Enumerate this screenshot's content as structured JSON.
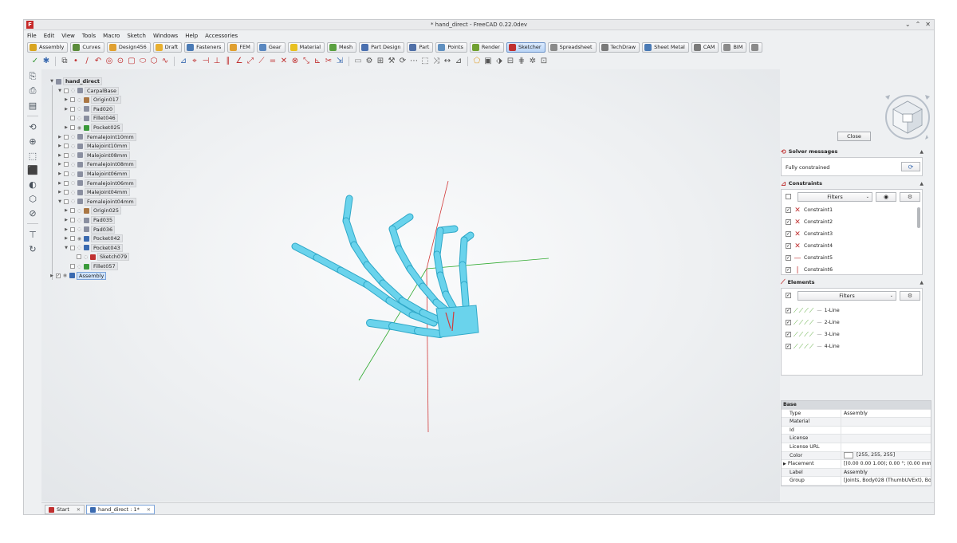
{
  "window": {
    "title": "* hand_direct - FreeCAD 0.22.0dev",
    "logo": "F",
    "btn_min": "⌄",
    "btn_max": "⌃",
    "btn_close": "✕"
  },
  "menu": [
    "File",
    "Edit",
    "View",
    "Tools",
    "Macro",
    "Sketch",
    "Windows",
    "Help",
    "Accessories"
  ],
  "workbenches": [
    {
      "label": "Assembly",
      "color": "#d9a520"
    },
    {
      "label": "Curves",
      "color": "#5b8c3a"
    },
    {
      "label": "Design456",
      "color": "#e0a030"
    },
    {
      "label": "Draft",
      "color": "#e8b030"
    },
    {
      "label": "Fasteners",
      "color": "#4a7ab5"
    },
    {
      "label": "FEM",
      "color": "#e0a030"
    },
    {
      "label": "Gear",
      "color": "#5a88c0"
    },
    {
      "label": "Material",
      "color": "#e8c020"
    },
    {
      "label": "Mesh",
      "color": "#5aa040"
    },
    {
      "label": "Part Design",
      "color": "#4a70b0"
    },
    {
      "label": "Part",
      "color": "#5070a8"
    },
    {
      "label": "Points",
      "color": "#6090c0"
    },
    {
      "label": "Render",
      "color": "#70a030"
    },
    {
      "label": "Sketcher",
      "color": "#c03030"
    },
    {
      "label": "Spreadsheet",
      "color": "#8a8a8a"
    },
    {
      "label": "TechDraw",
      "color": "#7a7a7a"
    },
    {
      "label": "Sheet Metal",
      "color": "#4a7ab5"
    },
    {
      "label": "CAM",
      "color": "#7a7a7a"
    },
    {
      "label": "BIM",
      "color": "#8a8a8a"
    },
    {
      "label": "",
      "color": "#8a8a8a"
    }
  ],
  "toolbar_icons": [
    {
      "glyph": "✓",
      "color": "#3a9a3a"
    },
    {
      "glyph": "✱",
      "color": "#3a6ab0"
    },
    {
      "glyph": "⧉",
      "color": "#555"
    },
    {
      "glyph": "•",
      "color": "#c03030"
    },
    {
      "glyph": "∕",
      "color": "#c03030"
    },
    {
      "glyph": "↶",
      "color": "#c03030"
    },
    {
      "glyph": "◎",
      "color": "#c03030"
    },
    {
      "glyph": "⊙",
      "color": "#c03030"
    },
    {
      "glyph": "▢",
      "color": "#c03030"
    },
    {
      "glyph": "⬭",
      "color": "#c03030"
    },
    {
      "glyph": "⬡",
      "color": "#c03030"
    },
    {
      "glyph": "∿",
      "color": "#c03030"
    },
    {
      "glyph": "⊿",
      "color": "#3a6ab0"
    },
    {
      "glyph": "⌖",
      "color": "#c03030"
    },
    {
      "glyph": "⊣",
      "color": "#c03030"
    },
    {
      "glyph": "⊥",
      "color": "#c03030"
    },
    {
      "glyph": "∥",
      "color": "#c03030"
    },
    {
      "glyph": "∠",
      "color": "#c03030"
    },
    {
      "glyph": "⤢",
      "color": "#c03030"
    },
    {
      "glyph": "⟋",
      "color": "#c03030"
    },
    {
      "glyph": "=",
      "color": "#c03030"
    },
    {
      "glyph": "✕",
      "color": "#c03030"
    },
    {
      "glyph": "⊗",
      "color": "#c03030"
    },
    {
      "glyph": "⤡",
      "color": "#c03030"
    },
    {
      "glyph": "⊾",
      "color": "#c03030"
    },
    {
      "glyph": "✂",
      "color": "#c03030"
    },
    {
      "glyph": "⇲",
      "color": "#3a6ab0"
    },
    {
      "glyph": "▭",
      "color": "#888"
    },
    {
      "glyph": "⚙",
      "color": "#555"
    },
    {
      "glyph": "⊞",
      "color": "#555"
    },
    {
      "glyph": "⚒",
      "color": "#555"
    },
    {
      "glyph": "⟳",
      "color": "#555"
    },
    {
      "glyph": "⋯",
      "color": "#555"
    },
    {
      "glyph": "⬚",
      "color": "#555"
    },
    {
      "glyph": "⤨",
      "color": "#555"
    },
    {
      "glyph": "↔",
      "color": "#555"
    },
    {
      "glyph": "⊿",
      "color": "#555"
    },
    {
      "glyph": "⬠",
      "color": "#e0a030"
    },
    {
      "glyph": "▣",
      "color": "#555"
    },
    {
      "glyph": "⬗",
      "color": "#555"
    },
    {
      "glyph": "⊟",
      "color": "#555"
    },
    {
      "glyph": "⋕",
      "color": "#555"
    },
    {
      "glyph": "✲",
      "color": "#555"
    },
    {
      "glyph": "⊡",
      "color": "#555"
    }
  ],
  "leftbar_icons": [
    "new-doc",
    "open-doc",
    "save-doc",
    "fit-all",
    "zoom",
    "view-iso",
    "view-front",
    "draw-style",
    "view-axo",
    "measure",
    "std-part",
    "refresh"
  ],
  "tree": {
    "root": "hand_direct",
    "items": [
      {
        "label": "CarpalBase",
        "depth": 1,
        "exp": "▼",
        "eye": "◌",
        "color": "#8a8fa0"
      },
      {
        "label": "Origin017",
        "depth": 2,
        "exp": "▶",
        "eye": "◌",
        "color": "#aa7744"
      },
      {
        "label": "Pad020",
        "depth": 2,
        "exp": "▶",
        "eye": "◌",
        "color": "#8a8fa0"
      },
      {
        "label": "Fillet046",
        "depth": 2,
        "exp": "",
        "eye": "◌",
        "color": "#8a8fa0"
      },
      {
        "label": "Pocket025",
        "depth": 2,
        "exp": "▶",
        "eye": "◉",
        "color": "#3a9a3a"
      },
      {
        "label": "Femalejoint10mm",
        "depth": 1,
        "exp": "▶",
        "eye": "◌",
        "color": "#8a8fa0"
      },
      {
        "label": "Malejoint10mm",
        "depth": 1,
        "exp": "▶",
        "eye": "◌",
        "color": "#8a8fa0"
      },
      {
        "label": "Malejoint08mm",
        "depth": 1,
        "exp": "▶",
        "eye": "◌",
        "color": "#8a8fa0"
      },
      {
        "label": "Femalejoint08mm",
        "depth": 1,
        "exp": "▶",
        "eye": "◌",
        "color": "#8a8fa0"
      },
      {
        "label": "Malejoint06mm",
        "depth": 1,
        "exp": "▶",
        "eye": "◌",
        "color": "#8a8fa0"
      },
      {
        "label": "Femalejoint06mm",
        "depth": 1,
        "exp": "▶",
        "eye": "◌",
        "color": "#8a8fa0"
      },
      {
        "label": "Malejoint04mm",
        "depth": 1,
        "exp": "▶",
        "eye": "◌",
        "color": "#8a8fa0"
      },
      {
        "label": "Femalejoint04mm",
        "depth": 1,
        "exp": "▼",
        "eye": "◌",
        "color": "#8a8fa0"
      },
      {
        "label": "Origin025",
        "depth": 2,
        "exp": "▶",
        "eye": "◌",
        "color": "#aa7744"
      },
      {
        "label": "Pad035",
        "depth": 2,
        "exp": "▶",
        "eye": "◌",
        "color": "#8a8fa0"
      },
      {
        "label": "Pad036",
        "depth": 2,
        "exp": "▶",
        "eye": "◌",
        "color": "#8a8fa0"
      },
      {
        "label": "Pocket042",
        "depth": 2,
        "exp": "▶",
        "eye": "◉",
        "color": "#3a6ab0"
      },
      {
        "label": "Pocket043",
        "depth": 2,
        "exp": "▼",
        "eye": "◌",
        "color": "#3a6ab0"
      },
      {
        "label": "Sketch079",
        "depth": 3,
        "exp": "",
        "eye": "◌",
        "color": "#c03030"
      },
      {
        "label": "Fillet057",
        "depth": 2,
        "exp": "",
        "eye": "◌",
        "color": "#3a9a3a"
      },
      {
        "label": "Assembly",
        "depth": 0,
        "exp": "▶",
        "eye": "◉",
        "color": "#3a6ab0",
        "selected": true,
        "checked": "✓"
      }
    ]
  },
  "task": {
    "close_label": "Close",
    "solver": {
      "title": "Solver messages",
      "status": "Fully constrained",
      "refresh_icon": "⟳"
    },
    "constraints": {
      "title": "Constraints",
      "filter_label": "Filters",
      "items": [
        {
          "label": "Constraint1",
          "glyph": "✕"
        },
        {
          "label": "Constraint2",
          "glyph": "✕"
        },
        {
          "label": "Constraint3",
          "glyph": "✕"
        },
        {
          "label": "Constraint4",
          "glyph": "✕"
        },
        {
          "label": "Constraint5",
          "glyph": "—"
        },
        {
          "label": "Constraint6",
          "glyph": "|"
        }
      ]
    },
    "elements": {
      "title": "Elements",
      "filter_label": "Filters",
      "items": [
        {
          "label": "1-Line"
        },
        {
          "label": "2-Line"
        },
        {
          "label": "3-Line"
        },
        {
          "label": "4-Line"
        }
      ]
    }
  },
  "properties": {
    "group": "Base",
    "rows": [
      {
        "key": "Type",
        "value": "Assembly"
      },
      {
        "key": "Material",
        "value": ""
      },
      {
        "key": "Id",
        "value": ""
      },
      {
        "key": "License",
        "value": ""
      },
      {
        "key": "License URL",
        "value": ""
      },
      {
        "key": "Color",
        "value": "[255, 255, 255]"
      },
      {
        "key": "Placement",
        "value": "[(0.00 0.00 1.00); 0.00 °; (0.00 mm  0.0..."
      },
      {
        "key": "Label",
        "value": "Assembly"
      },
      {
        "key": "Group",
        "value": "[Joints, Body028 (ThumbUVExt), Body..."
      }
    ]
  },
  "tabs": [
    {
      "label": "Start",
      "icon_color": "#c03030",
      "active": false
    },
    {
      "label": "hand_direct : 1*",
      "icon_color": "#3a6ab0",
      "active": true
    }
  ],
  "colors": {
    "model": "#6ad3ec",
    "model_edge": "#2fa8c8",
    "axis_x": "#d23a3a",
    "axis_y": "#2faa2f"
  }
}
